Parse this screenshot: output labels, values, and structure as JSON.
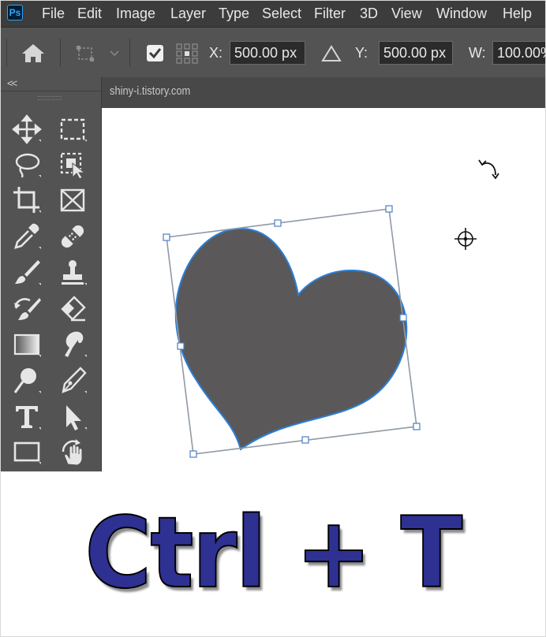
{
  "app": {
    "logo": "Ps"
  },
  "menu": [
    "File",
    "Edit",
    "Image",
    "Layer",
    "Type",
    "Select",
    "Filter",
    "3D",
    "View",
    "Window",
    "Help"
  ],
  "options": {
    "x_label": "X:",
    "x_value": "500.00 px",
    "y_label": "Y:",
    "y_value": "500.00 px",
    "w_label": "W:",
    "w_value": "100.00%"
  },
  "toolbox": {
    "collapse_label": "<<"
  },
  "document": {
    "tab_title": "shiny-i.tistory.com"
  },
  "colors": {
    "heart_fill": "#5a5859",
    "heart_outline": "#2b7fd8",
    "caption": "#2e3192",
    "chrome_dark": "#3c3c3c",
    "chrome": "#535353"
  },
  "tools": [
    "move-icon",
    "marquee-icon",
    "lasso-icon",
    "object-select-icon",
    "crop-icon",
    "frame-icon",
    "eyedropper-icon",
    "healing-bandage-icon",
    "brush-icon",
    "stamp-icon",
    "history-brush-icon",
    "eraser-icon",
    "gradient-icon",
    "smudge-icon",
    "dodge-icon",
    "pen-icon",
    "type-icon",
    "path-select-icon",
    "rectangle-icon",
    "hand-icon"
  ],
  "caption": "Ctrl + T"
}
